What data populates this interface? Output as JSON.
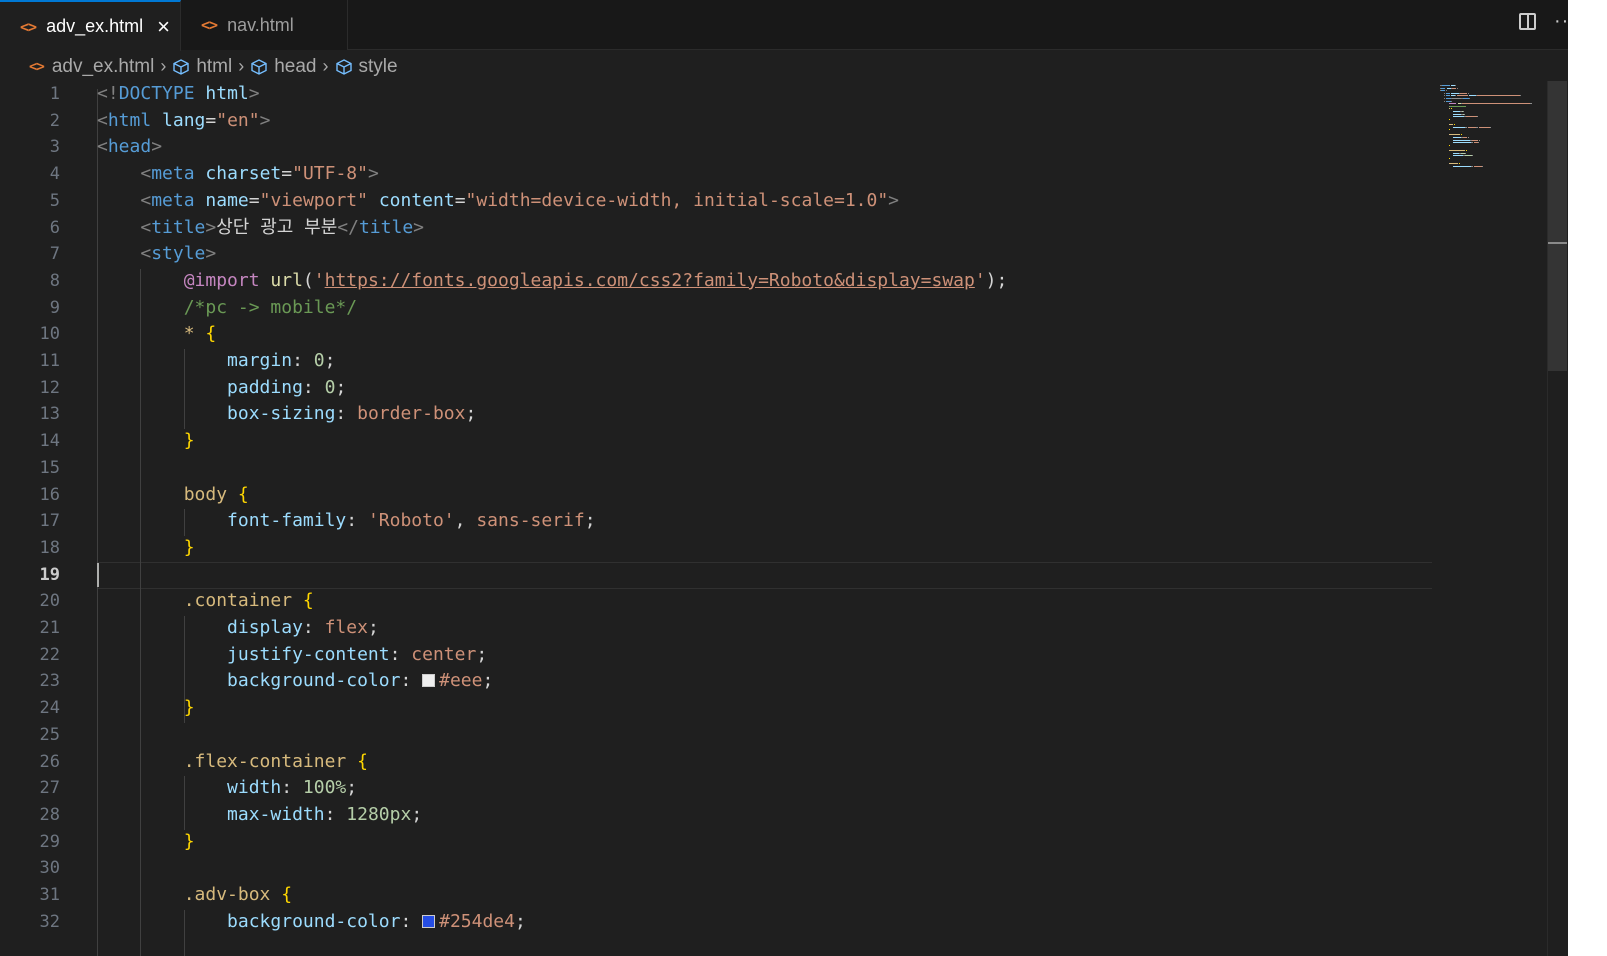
{
  "tabs": [
    {
      "icon": "html-file-icon",
      "label": "adv_ex.html",
      "active": true
    },
    {
      "icon": "html-file-icon",
      "label": "nav.html",
      "active": false
    }
  ],
  "breadcrumb": [
    {
      "icon": "html-file-icon",
      "label": "adv_ex.html"
    },
    {
      "icon": "cube-icon",
      "label": "html"
    },
    {
      "icon": "cube-icon",
      "label": "head"
    },
    {
      "icon": "cube-icon",
      "label": "style"
    }
  ],
  "editor": {
    "current_line": 19,
    "lines": [
      {
        "n": "1",
        "tokens": [
          [
            "p",
            "<!"
          ],
          [
            "tag",
            "DOCTYPE"
          ],
          [
            "txt",
            " "
          ],
          [
            "attr",
            "html"
          ],
          [
            "p",
            ">"
          ]
        ]
      },
      {
        "n": "2",
        "tokens": [
          [
            "p",
            "<"
          ],
          [
            "tag",
            "html"
          ],
          [
            "txt",
            " "
          ],
          [
            "attr",
            "lang"
          ],
          [
            "txt",
            "="
          ],
          [
            "str",
            "\"en\""
          ],
          [
            "p",
            ">"
          ]
        ]
      },
      {
        "n": "3",
        "tokens": [
          [
            "p",
            "<"
          ],
          [
            "tag",
            "head"
          ],
          [
            "p",
            ">"
          ]
        ]
      },
      {
        "n": "4",
        "tokens": [
          [
            "txt",
            "    "
          ],
          [
            "p",
            "<"
          ],
          [
            "tag",
            "meta"
          ],
          [
            "txt",
            " "
          ],
          [
            "attr",
            "charset"
          ],
          [
            "txt",
            "="
          ],
          [
            "str",
            "\"UTF-8\""
          ],
          [
            "p",
            ">"
          ]
        ]
      },
      {
        "n": "5",
        "tokens": [
          [
            "txt",
            "    "
          ],
          [
            "p",
            "<"
          ],
          [
            "tag",
            "meta"
          ],
          [
            "txt",
            " "
          ],
          [
            "attr",
            "name"
          ],
          [
            "txt",
            "="
          ],
          [
            "str",
            "\"viewport\""
          ],
          [
            "txt",
            " "
          ],
          [
            "attr",
            "content"
          ],
          [
            "txt",
            "="
          ],
          [
            "str",
            "\"width=device-width, initial-scale=1.0\""
          ],
          [
            "p",
            ">"
          ]
        ]
      },
      {
        "n": "6",
        "tokens": [
          [
            "txt",
            "    "
          ],
          [
            "p",
            "<"
          ],
          [
            "tag",
            "title"
          ],
          [
            "p",
            ">"
          ],
          [
            "txt",
            "상단 광고 부분"
          ],
          [
            "p",
            "</"
          ],
          [
            "tag",
            "title"
          ],
          [
            "p",
            ">"
          ]
        ]
      },
      {
        "n": "7",
        "tokens": [
          [
            "txt",
            "    "
          ],
          [
            "p",
            "<"
          ],
          [
            "tag",
            "style"
          ],
          [
            "p",
            ">"
          ]
        ]
      },
      {
        "n": "8",
        "tokens": [
          [
            "txt",
            "        "
          ],
          [
            "at",
            "@import"
          ],
          [
            "txt",
            " "
          ],
          [
            "fn",
            "url"
          ],
          [
            "txt",
            "("
          ],
          [
            "str",
            "'"
          ],
          [
            "url",
            "https://fonts.googleapis.com/css2?family=Roboto&display=swap"
          ],
          [
            "str",
            "'"
          ],
          [
            "txt",
            ");"
          ]
        ]
      },
      {
        "n": "9",
        "tokens": [
          [
            "txt",
            "        "
          ],
          [
            "com",
            "/*pc -> mobile*/"
          ]
        ]
      },
      {
        "n": "10",
        "tokens": [
          [
            "txt",
            "        "
          ],
          [
            "sel",
            "*"
          ],
          [
            "txt",
            " "
          ],
          [
            "br",
            "{"
          ]
        ]
      },
      {
        "n": "11",
        "tokens": [
          [
            "txt",
            "            "
          ],
          [
            "prop",
            "margin"
          ],
          [
            "txt",
            ": "
          ],
          [
            "num",
            "0"
          ],
          [
            "txt",
            ";"
          ]
        ]
      },
      {
        "n": "12",
        "tokens": [
          [
            "txt",
            "            "
          ],
          [
            "prop",
            "padding"
          ],
          [
            "txt",
            ": "
          ],
          [
            "num",
            "0"
          ],
          [
            "txt",
            ";"
          ]
        ]
      },
      {
        "n": "13",
        "tokens": [
          [
            "txt",
            "            "
          ],
          [
            "prop",
            "box-sizing"
          ],
          [
            "txt",
            ": "
          ],
          [
            "val",
            "border-box"
          ],
          [
            "txt",
            ";"
          ]
        ]
      },
      {
        "n": "14",
        "tokens": [
          [
            "txt",
            "        "
          ],
          [
            "br",
            "}"
          ]
        ]
      },
      {
        "n": "15",
        "tokens": []
      },
      {
        "n": "16",
        "tokens": [
          [
            "txt",
            "        "
          ],
          [
            "sel",
            "body"
          ],
          [
            "txt",
            " "
          ],
          [
            "br",
            "{"
          ]
        ]
      },
      {
        "n": "17",
        "tokens": [
          [
            "txt",
            "            "
          ],
          [
            "prop",
            "font-family"
          ],
          [
            "txt",
            ": "
          ],
          [
            "str",
            "'Roboto'"
          ],
          [
            "txt",
            ", "
          ],
          [
            "val",
            "sans-serif"
          ],
          [
            "txt",
            ";"
          ]
        ]
      },
      {
        "n": "18",
        "tokens": [
          [
            "txt",
            "        "
          ],
          [
            "br",
            "}"
          ]
        ]
      },
      {
        "n": "19",
        "tokens": []
      },
      {
        "n": "20",
        "tokens": [
          [
            "txt",
            "        "
          ],
          [
            "sel",
            ".container"
          ],
          [
            "txt",
            " "
          ],
          [
            "br",
            "{"
          ]
        ]
      },
      {
        "n": "21",
        "tokens": [
          [
            "txt",
            "            "
          ],
          [
            "prop",
            "display"
          ],
          [
            "txt",
            ": "
          ],
          [
            "val",
            "flex"
          ],
          [
            "txt",
            ";"
          ]
        ]
      },
      {
        "n": "22",
        "tokens": [
          [
            "txt",
            "            "
          ],
          [
            "prop",
            "justify-content"
          ],
          [
            "txt",
            ": "
          ],
          [
            "val",
            "center"
          ],
          [
            "txt",
            ";"
          ]
        ]
      },
      {
        "n": "23",
        "tokens": [
          [
            "txt",
            "            "
          ],
          [
            "prop",
            "background-color"
          ],
          [
            "txt",
            ": "
          ],
          [
            "swatch",
            "#eeeeee"
          ],
          [
            "val",
            "#eee"
          ],
          [
            "txt",
            ";"
          ]
        ]
      },
      {
        "n": "24",
        "tokens": [
          [
            "txt",
            "        "
          ],
          [
            "br",
            "}"
          ]
        ]
      },
      {
        "n": "25",
        "tokens": []
      },
      {
        "n": "26",
        "tokens": [
          [
            "txt",
            "        "
          ],
          [
            "sel",
            ".flex-container"
          ],
          [
            "txt",
            " "
          ],
          [
            "br",
            "{"
          ]
        ]
      },
      {
        "n": "27",
        "tokens": [
          [
            "txt",
            "            "
          ],
          [
            "prop",
            "width"
          ],
          [
            "txt",
            ": "
          ],
          [
            "num",
            "100%"
          ],
          [
            "txt",
            ";"
          ]
        ]
      },
      {
        "n": "28",
        "tokens": [
          [
            "txt",
            "            "
          ],
          [
            "prop",
            "max-width"
          ],
          [
            "txt",
            ": "
          ],
          [
            "num",
            "1280px"
          ],
          [
            "txt",
            ";"
          ]
        ]
      },
      {
        "n": "29",
        "tokens": [
          [
            "txt",
            "        "
          ],
          [
            "br",
            "}"
          ]
        ]
      },
      {
        "n": "30",
        "tokens": []
      },
      {
        "n": "31",
        "tokens": [
          [
            "txt",
            "        "
          ],
          [
            "sel",
            ".adv-box"
          ],
          [
            "txt",
            " "
          ],
          [
            "br",
            "{"
          ]
        ]
      },
      {
        "n": "32",
        "tokens": [
          [
            "txt",
            "            "
          ],
          [
            "prop",
            "background-color"
          ],
          [
            "txt",
            ": "
          ],
          [
            "swatch",
            "#254de4"
          ],
          [
            "val",
            "#254de4"
          ],
          [
            "txt",
            ";"
          ]
        ]
      }
    ]
  },
  "colors": {
    "accent": "#0078d4",
    "editor_bg": "#1f1f1f",
    "tab_bar_bg": "#181818"
  }
}
